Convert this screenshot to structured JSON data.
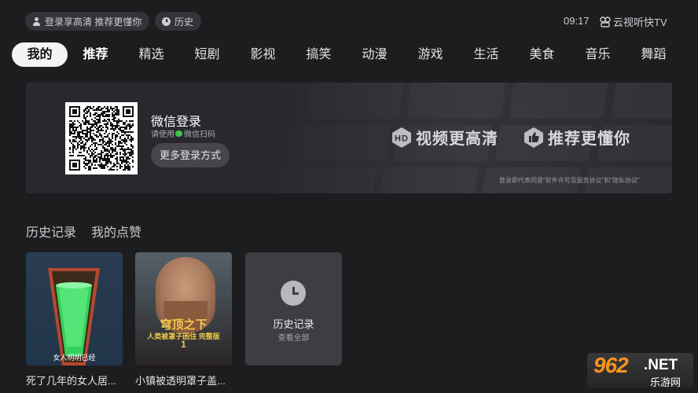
{
  "topbar": {
    "login_prompt": "登录享高清 推荐更懂你",
    "history_label": "历史",
    "time": "09:17",
    "brand": "云视听快TV"
  },
  "tabs": [
    "我的",
    "推荐",
    "精选",
    "短剧",
    "影视",
    "搞笑",
    "动漫",
    "游戏",
    "生活",
    "美食",
    "音乐",
    "舞蹈"
  ],
  "login_banner": {
    "title": "微信登录",
    "subtitle_prefix": "请使用",
    "subtitle_suffix": "微信扫码",
    "more_login": "更多登录方式",
    "promo_left": "视频更高清",
    "promo_right": "推荐更懂你",
    "agreement": "登录即代表同意“软件许可及服务协议”和“隐私协议”"
  },
  "sections": [
    "历史记录",
    "我的点赞"
  ],
  "history_cards": [
    {
      "overlay": "女人明明已经",
      "caption": "死了几年的女人居..."
    },
    {
      "poster_title": "穹顶之下",
      "poster_sub": "人类被罩子困住 完整版",
      "poster_num": "1",
      "caption": "小镇被透明罩子盖..."
    }
  ],
  "history_tile": {
    "title": "历史记录",
    "sub": "查看全部"
  },
  "watermark": {
    "number": "962",
    "domain": ".NET",
    "name": "乐游网"
  }
}
